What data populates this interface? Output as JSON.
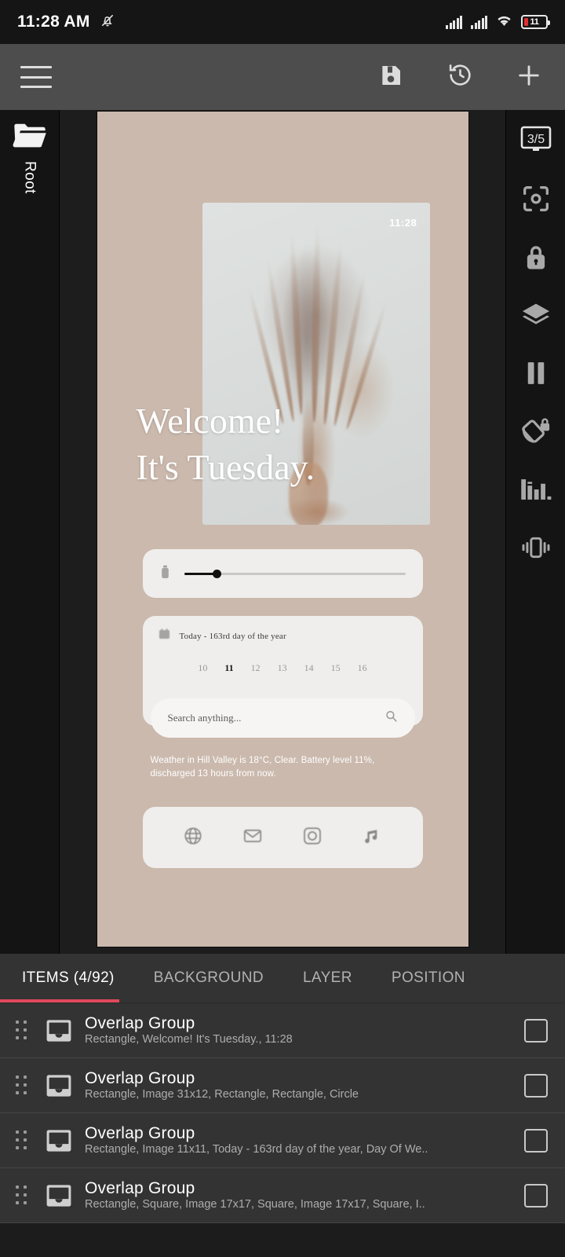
{
  "status_bar": {
    "clock": "11:28 AM",
    "icons": [
      "notifications-muted-icon",
      "signal-1-icon",
      "signal-2-icon",
      "wifi-icon",
      "battery-icon"
    ],
    "battery_level": "11"
  },
  "app_bar": {
    "menu_icon": "hamburger-menu-icon",
    "actions": [
      {
        "name": "save-button",
        "icon": "floppy-disk-icon"
      },
      {
        "name": "history-button",
        "icon": "clock-rotate-left-icon"
      },
      {
        "name": "add-button",
        "icon": "plus-icon"
      }
    ]
  },
  "left_rail": {
    "folder_icon": "folder-icon",
    "label": "Root"
  },
  "right_rail": {
    "buttons": [
      {
        "name": "page-indicator",
        "icon": "screen-icon",
        "label": "3/5"
      },
      {
        "name": "focus-button",
        "icon": "focus-frame-icon"
      },
      {
        "name": "lock-button",
        "icon": "padlock-icon"
      },
      {
        "name": "layers-button",
        "icon": "layers-stack-icon"
      },
      {
        "name": "pause-button",
        "icon": "pause-icon"
      },
      {
        "name": "rotation-lock-button",
        "icon": "rotation-lock-icon"
      },
      {
        "name": "stats-button",
        "icon": "bar-chart-icon"
      },
      {
        "name": "vibration-button",
        "icon": "vibrate-icon"
      }
    ]
  },
  "canvas": {
    "background_color": "#cbb9ad",
    "photo": {
      "clock": "11:28"
    },
    "headline_line1": "Welcome!",
    "headline_line2": "It's Tuesday.",
    "slider": {
      "icon": "brightness-icon",
      "value_percent": 13
    },
    "day_card": {
      "icon": "calendar-icon",
      "title": "Today - 163rd day of the year",
      "days": [
        "10",
        "11",
        "12",
        "13",
        "14",
        "15",
        "16"
      ],
      "active_day": "11"
    },
    "search": {
      "placeholder": "Search anything...",
      "icon": "search-icon"
    },
    "weather_text": "Weather in Hill Valley is 18°C, Clear. Battery level 11%, discharged 13 hours from now.",
    "dock": [
      {
        "name": "dock-browser",
        "icon": "globe-icon"
      },
      {
        "name": "dock-mail",
        "icon": "envelope-icon"
      },
      {
        "name": "dock-camera",
        "icon": "camera-icon"
      },
      {
        "name": "dock-music",
        "icon": "music-note-icon"
      }
    ]
  },
  "tabs": [
    {
      "label": "ITEMS (4/92)",
      "active": true
    },
    {
      "label": "BACKGROUND",
      "active": false
    },
    {
      "label": "LAYER",
      "active": false
    },
    {
      "label": "POSITION",
      "active": false
    }
  ],
  "accent_color": "#e0485c",
  "items": [
    {
      "title": "Overlap Group",
      "subtitle": "Rectangle, Welcome! It's Tuesday., 11:28",
      "icon": "overlap-group-icon",
      "checked": false
    },
    {
      "title": "Overlap Group",
      "subtitle": "Rectangle, Image 31x12, Rectangle, Rectangle, Circle",
      "icon": "overlap-group-icon",
      "checked": false
    },
    {
      "title": "Overlap Group",
      "subtitle": "Rectangle, Image 11x11, Today - 163rd day of the year, Day Of We..",
      "icon": "overlap-group-icon",
      "checked": false
    },
    {
      "title": "Overlap Group",
      "subtitle": "Rectangle, Square, Image 17x17, Square, Image 17x17, Square, I..",
      "icon": "overlap-group-icon",
      "checked": false
    }
  ]
}
